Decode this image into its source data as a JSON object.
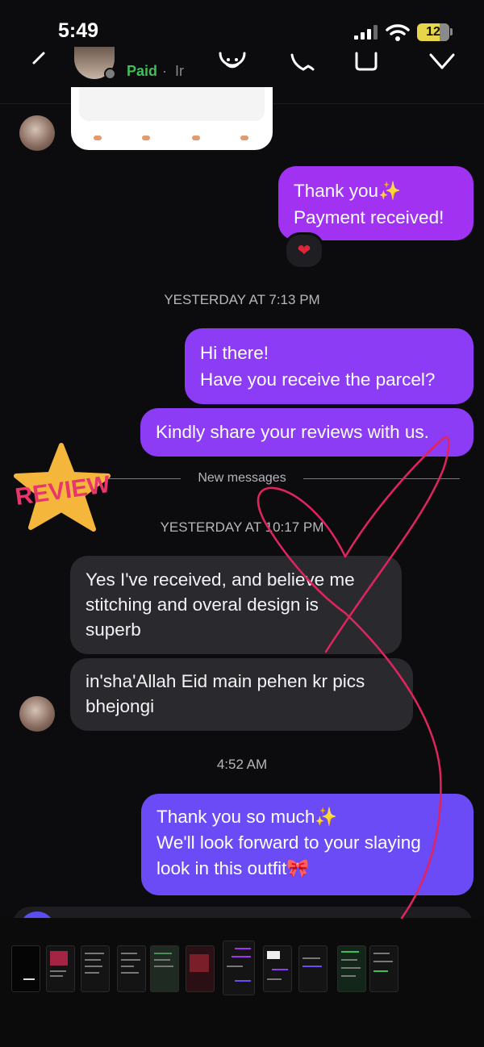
{
  "status_bar": {
    "time": "5:49",
    "battery": "12"
  },
  "header": {
    "status_label": "Paid",
    "separator": "·",
    "status_extra": "Ir"
  },
  "messages": {
    "m1": "Thank you✨\nPayment received!",
    "m1_reaction": "❤",
    "ts1": "YESTERDAY AT 7:13 PM",
    "m2": "Hi there!\nHave you receive the parcel?",
    "m3": "Kindly share your reviews with us.",
    "new_messages": "New messages",
    "ts2": "YESTERDAY AT 10:17 PM",
    "m4": "Yes I've received, and believe me\nstitching and overal design is\nsuperb",
    "m5": "in'sha'Allah Eid main pehen kr pics\nbhejongi",
    "ts3": "4:52 AM",
    "m6": "Thank you so much✨\nWe'll look forward to your slaying\nlook in this outfit🎀"
  },
  "sticker": {
    "text": "REVIEW",
    "star_color": "#f5b73b",
    "text_color": "#e8366c"
  },
  "colors": {
    "bubble_out": "#a132f2",
    "bubble_out_last": "#6a4bf6",
    "bubble_in": "#2a2a2e",
    "annotation": "#e0245e"
  }
}
